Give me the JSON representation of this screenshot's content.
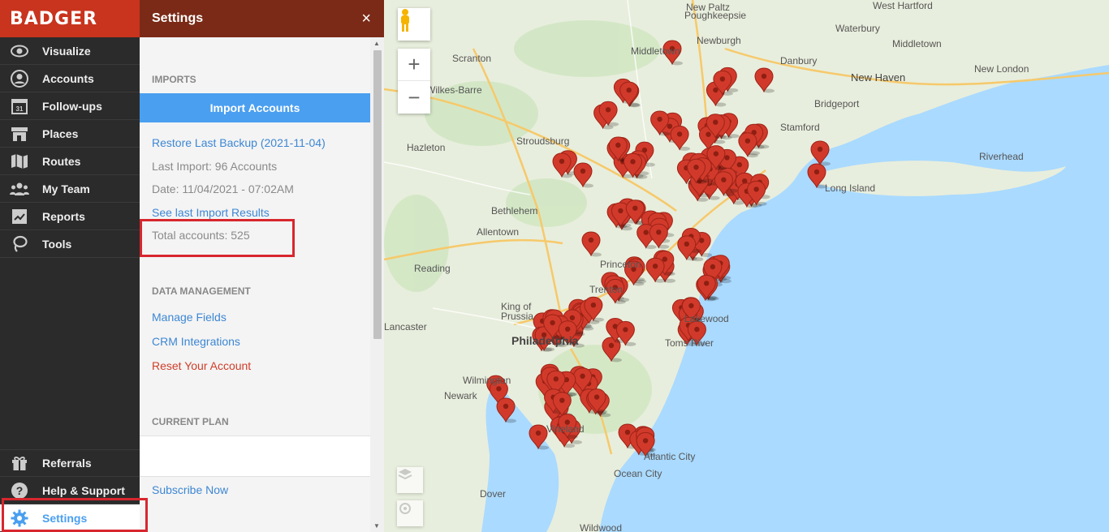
{
  "app": {
    "brand": "BADGER"
  },
  "nav": {
    "items": [
      {
        "label": "Visualize",
        "icon": "eye-icon"
      },
      {
        "label": "Accounts",
        "icon": "person-circle-icon"
      },
      {
        "label": "Follow-ups",
        "icon": "calendar-icon",
        "badge": "31"
      },
      {
        "label": "Places",
        "icon": "store-icon"
      },
      {
        "label": "Routes",
        "icon": "map-folded-icon"
      },
      {
        "label": "My Team",
        "icon": "team-icon"
      },
      {
        "label": "Reports",
        "icon": "report-icon"
      },
      {
        "label": "Tools",
        "icon": "lasso-icon"
      }
    ],
    "bottom_items": [
      {
        "label": "Referrals",
        "icon": "gift-icon"
      },
      {
        "label": "Help & Support",
        "icon": "question-icon"
      },
      {
        "label": "Settings",
        "icon": "gear-icon",
        "active": true
      }
    ]
  },
  "settings": {
    "title": "Settings",
    "close": "×",
    "imports_heading": "IMPORTS",
    "import_button": "Import Accounts",
    "restore_link": "Restore Last Backup (2021-11-04)",
    "last_import": "Last Import: 96 Accounts",
    "date": "Date: 11/04/2021 - 07:02AM",
    "see_results": "See last Import Results",
    "total_accounts": "Total accounts: 525",
    "data_heading": "DATA MANAGEMENT",
    "manage_fields": "Manage Fields",
    "crm_integrations": "CRM Integrations",
    "reset_account": "Reset Your Account",
    "plan_heading": "CURRENT PLAN",
    "subscribe": "Subscribe Now"
  },
  "map": {
    "zoom_in": "+",
    "zoom_out": "−",
    "labels": [
      "New Paltz",
      "Poughkeepsie",
      "West Hartford",
      "Waterbury",
      "Middletown",
      "Newburgh",
      "Middletown",
      "Danbury",
      "New Haven",
      "New London",
      "Scranton",
      "Wilkes-Barre",
      "Bridgeport",
      "Stamford",
      "Hazleton",
      "Stroudsburg",
      "Riverhead",
      "Long Island",
      "Bethlehem",
      "Allentown",
      "Reading",
      "Princeton",
      "Trenton",
      "King of Prussia",
      "Philadelphia",
      "Lakewood",
      "Toms River",
      "Wilmington",
      "Newark",
      "Vineland",
      "Atlantic City",
      "Ocean City",
      "Dover",
      "Wildwood",
      "Lancaster"
    ],
    "colors": {
      "marker": "#d13a2b",
      "land": "#e8eedd",
      "water": "#aadaff",
      "nav_bg": "#2b2b2b",
      "accent": "#4a9ff0",
      "header": "#7a2a16",
      "logo_bg": "#c8341e"
    }
  }
}
